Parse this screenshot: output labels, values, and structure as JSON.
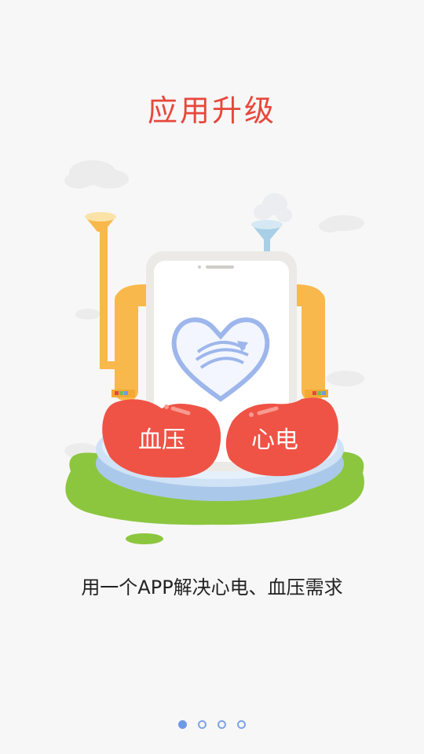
{
  "title": "应用升级",
  "illustration": {
    "left_badge": "血压",
    "right_badge": "心电"
  },
  "subtitle": "用一个APP解决心电、血压需求",
  "pager": {
    "total": 4,
    "active_index": 0
  },
  "colors": {
    "title": "#e8473b",
    "accent_red": "#ef5346",
    "pipe_yellow": "#f9b84b",
    "grass_green": "#8cc63f",
    "dot_blue": "#6f98e7"
  }
}
